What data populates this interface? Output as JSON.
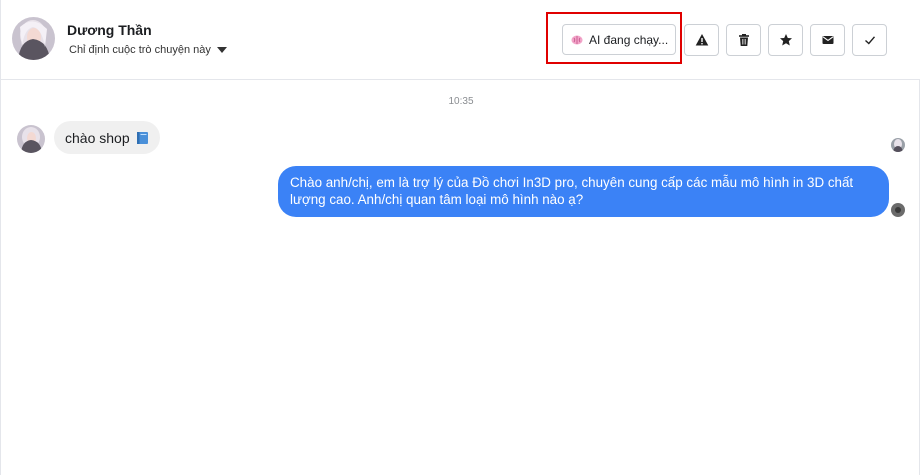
{
  "header": {
    "contact_name": "Dương Thần",
    "assign_label": "Chỉ định cuộc trò chuyện này",
    "ai_status_label": "AI đang chạy...",
    "actions": [
      {
        "icon": "warning-icon"
      },
      {
        "icon": "trash-icon"
      },
      {
        "icon": "star-icon"
      },
      {
        "icon": "mail-icon"
      },
      {
        "icon": "check-icon"
      }
    ]
  },
  "conversation": {
    "timestamp": "10:35",
    "messages": [
      {
        "direction": "incoming",
        "text": "chào shop",
        "emoji_icon": "blue-book-icon"
      },
      {
        "direction": "outgoing",
        "text": "Chào anh/chị, em là trợ lý của Đồ chơi In3D pro, chuyên cung cấp các mẫu mô hình in 3D chất lượng cao. Anh/chị quan tâm loại mô hình nào ạ?"
      }
    ]
  },
  "colors": {
    "outgoing_bubble": "#3b82f6",
    "incoming_bubble": "#f0f0f0",
    "highlight_box": "#e00000"
  }
}
